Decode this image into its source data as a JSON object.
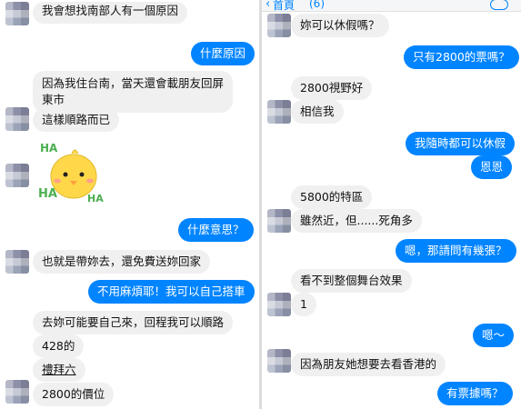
{
  "left_chat": {
    "messages": [
      {
        "text": "我會想找南部人有一個原因"
      },
      {
        "text": "什麼原因"
      },
      {
        "text": "因為我住台南，當天還會載朋友回屏"
      },
      {
        "text": "東市"
      },
      {
        "text": "這樣順路而已"
      },
      {
        "text": "HA"
      },
      {
        "text": "HA"
      },
      {
        "text": "HA"
      },
      {
        "text": "什麼意思？"
      },
      {
        "text": "也就是帶妳去，還免費送妳回家"
      },
      {
        "text": "不用麻煩耶！我可以自己搭車"
      },
      {
        "text": "去妳可能要自己來，回程我可以順路"
      },
      {
        "text": "428的"
      },
      {
        "text": "禮拜六"
      },
      {
        "text": "2800的價位"
      }
    ]
  },
  "right_chat": {
    "header": {
      "back_label": "首頁",
      "unread": "(6)"
    },
    "messages": [
      {
        "text": "妳可以休假嗎？"
      },
      {
        "text": "只有2800的票嗎？"
      },
      {
        "text": "2800視野好"
      },
      {
        "text": "相信我"
      },
      {
        "text": "我隨時都可以休假"
      },
      {
        "text": "恩恩"
      },
      {
        "text": "5800的特區"
      },
      {
        "text": "雖然近，但......死角多"
      },
      {
        "text": "嗯，那請問有幾張？"
      },
      {
        "text": "看不到整個舞台效果"
      },
      {
        "text": "1"
      },
      {
        "text": "嗯～"
      },
      {
        "text": "因為朋友她想要去看香港的"
      },
      {
        "text": "有票據嗎？"
      }
    ]
  },
  "colors": {
    "outgoing": "#0084ff",
    "incoming": "#f1f0f0",
    "chick": "#ffd84a",
    "ha_text": "#4caf50"
  }
}
